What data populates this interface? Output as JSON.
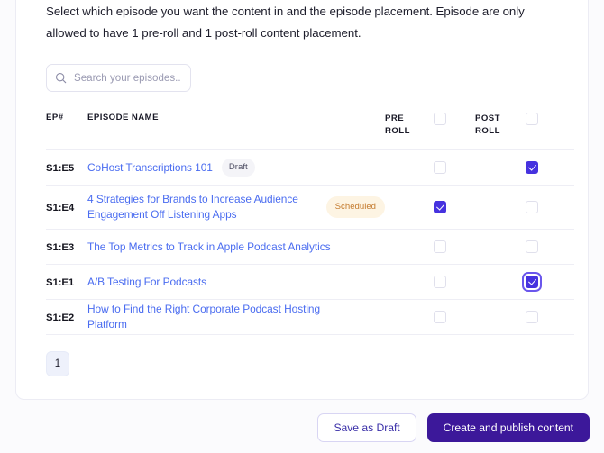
{
  "instructions": {
    "text": "Select which episode you want the content in and the episode placement. Episode are only allowed to have 1 pre-roll and 1 post-roll content placement."
  },
  "search": {
    "placeholder": "Search your episodes...",
    "value": "",
    "icon": "search-icon"
  },
  "table": {
    "columns": {
      "ep": "EP#",
      "name": "EPISODE NAME",
      "pre_line1": "PRE",
      "pre_line2": "ROLL",
      "post_line1": "POST",
      "post_line2": "ROLL"
    },
    "header_pre_checked": false,
    "header_post_checked": false,
    "rows": [
      {
        "ep": "S1:E5",
        "name": "CoHost Transcriptions 101",
        "badge": "Draft",
        "badge_type": "draft",
        "pre_checked": false,
        "post_checked": true,
        "post_focused": false
      },
      {
        "ep": "S1:E4",
        "name": "4 Strategies for Brands to Increase Audience Engagement Off Listening Apps",
        "badge": "Scheduled",
        "badge_type": "scheduled",
        "pre_checked": true,
        "post_checked": false,
        "post_focused": false
      },
      {
        "ep": "S1:E3",
        "name": "The Top Metrics to Track in Apple Podcast Analytics",
        "badge": "",
        "badge_type": "",
        "pre_checked": false,
        "post_checked": false,
        "post_focused": false
      },
      {
        "ep": "S1:E1",
        "name": "A/B Testing For Podcasts",
        "badge": "",
        "badge_type": "",
        "pre_checked": false,
        "post_checked": true,
        "post_focused": true
      },
      {
        "ep": "S1:E2",
        "name": "How to Find the Right Corporate Podcast Hosting Platform",
        "badge": "",
        "badge_type": "",
        "pre_checked": false,
        "post_checked": false,
        "post_focused": false
      }
    ]
  },
  "pagination": {
    "current_page": "1"
  },
  "footer": {
    "save_draft_label": "Save as Draft",
    "publish_label": "Create and publish content"
  },
  "colors": {
    "primary_purple": "#3c189a",
    "checkbox_purple": "#4632df",
    "link_blue": "#4a6cf0",
    "scheduled_bg": "#fdf4e3",
    "scheduled_text": "#c47a2d",
    "draft_bg": "#f4f4f8",
    "pager_bg": "#eef1fb"
  }
}
